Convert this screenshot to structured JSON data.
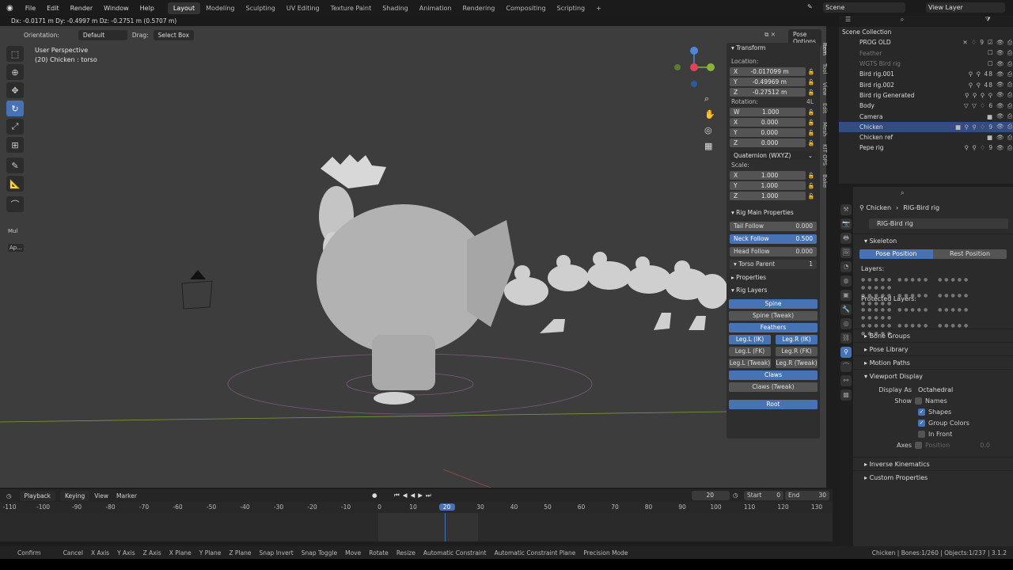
{
  "topbar": {
    "menus": [
      "File",
      "Edit",
      "Render",
      "Window",
      "Help"
    ],
    "workspaces": [
      "Layout",
      "Modeling",
      "Sculpting",
      "UV Editing",
      "Texture Paint",
      "Shading",
      "Animation",
      "Rendering",
      "Compositing",
      "Scripting"
    ],
    "active_workspace": "Layout",
    "scene": "Scene",
    "view_layer": "View Layer"
  },
  "viewport": {
    "header_text": "Dx: -0.0171 m   Dy: -0.4997 m   Dz: -0.2751 m (0.5707 m)",
    "orientation_label": "Orientation:",
    "orientation_value": "Default",
    "drag_label": "Drag:",
    "drag_value": "Select Box",
    "pose_options": "Pose Options",
    "perspective": "User Perspective",
    "object_info": "(20) Chicken : torso",
    "mul_label": "Mul",
    "ap_label": "Ap..."
  },
  "npanel": {
    "tabs": [
      "Item",
      "Tool",
      "View",
      "Edit",
      "Mesh",
      "KIT OPS",
      "Bake"
    ],
    "transform_title": "Transform",
    "location_label": "Location:",
    "location": [
      {
        "axis": "X",
        "value": "-0.017099 m"
      },
      {
        "axis": "Y",
        "value": "-0.49969 m"
      },
      {
        "axis": "Z",
        "value": "-0.27512 m"
      }
    ],
    "rotation_label": "Rotation:",
    "rotation_mode_tag": "4L",
    "rotation": [
      {
        "axis": "W",
        "value": "1.000"
      },
      {
        "axis": "X",
        "value": "0.000"
      },
      {
        "axis": "Y",
        "value": "0.000"
      },
      {
        "axis": "Z",
        "value": "0.000"
      }
    ],
    "rotation_mode": "Quaternion (WXYZ)",
    "scale_label": "Scale:",
    "scale": [
      {
        "axis": "X",
        "value": "1.000"
      },
      {
        "axis": "Y",
        "value": "1.000"
      },
      {
        "axis": "Z",
        "value": "1.000"
      }
    ],
    "rig_main_title": "Rig Main Properties",
    "tail_follow": {
      "label": "Tail Follow",
      "value": "0.000"
    },
    "neck_follow": {
      "label": "Neck Follow",
      "value": "0.500"
    },
    "head_follow": {
      "label": "Head Follow",
      "value": "0.000"
    },
    "torso_parent": {
      "label": "Torso Parent",
      "value": "1"
    },
    "properties_title": "Properties",
    "rig_layers_title": "Rig Layers",
    "layers": {
      "spine": "Spine",
      "spine_tweak": "Spine (Tweak)",
      "feathers": "Feathers",
      "leg_l_ik": "Leg.L (IK)",
      "leg_r_ik": "Leg.R (IK)",
      "leg_l_fk": "Leg.L (FK)",
      "leg_r_fk": "Leg.R (FK)",
      "leg_l_tweak": "Leg.L (Tweak)",
      "leg_r_tweak": "Leg.R (Tweak)",
      "claws": "Claws",
      "claws_tweak": "Claws (Tweak)",
      "root": "Root"
    }
  },
  "outliner": {
    "rows": [
      {
        "name": "Scene Collection",
        "icons": ""
      },
      {
        "name": "PROG OLD",
        "icons": "✕ ♢ 9"
      },
      {
        "name": "Feather",
        "icons": ""
      },
      {
        "name": "WGTS Bird rig",
        "icons": ""
      },
      {
        "name": "Bird rig.001",
        "icons": "⚲ ⚲ 48"
      },
      {
        "name": "Bird rig.002",
        "icons": "⚲ ⚲ 48"
      },
      {
        "name": "Bird rig Generated",
        "icons": "⚲ ⚲ ⚲ ⚲"
      },
      {
        "name": "Body",
        "icons": "▽ ▽ ♢ 6"
      },
      {
        "name": "Camera",
        "icons": "■"
      },
      {
        "name": "Chicken",
        "icons": "■ ⚲ ⚲ ♢ 9"
      },
      {
        "name": "Chicken ref",
        "icons": "■"
      },
      {
        "name": "Pepe rig",
        "icons": "⚲ ⚲ ♢ 9"
      }
    ]
  },
  "properties": {
    "breadcrumb_object": "Chicken",
    "breadcrumb_data": "RIG-Bird rig",
    "datablock": "RIG-Bird rig",
    "skeleton_title": "Skeleton",
    "pose_position": "Pose Position",
    "rest_position": "Rest Position",
    "layers_label": "Layers:",
    "protected_layers_label": "Protected Layers:",
    "bone_groups": "Bone Groups",
    "pose_library": "Pose Library",
    "motion_paths": "Motion Paths",
    "viewport_display": "Viewport Display",
    "display_as_label": "Display As",
    "display_as_value": "Octahedral",
    "show_label": "Show",
    "names": "Names",
    "shapes": "Shapes",
    "group_colors": "Group Colors",
    "in_front": "In Front",
    "axes_label": "Axes",
    "position_label": "Position",
    "position_value": "0.0",
    "inverse_kinematics": "Inverse Kinematics",
    "custom_properties": "Custom Properties"
  },
  "timeline": {
    "menus": [
      "Playback",
      "Keying",
      "View",
      "Marker"
    ],
    "current_frame": "20",
    "start_label": "Start",
    "start": "0",
    "end_label": "End",
    "end": "30",
    "ticks": [
      "-110",
      "-100",
      "-90",
      "-80",
      "-70",
      "-60",
      "-50",
      "-40",
      "-30",
      "-20",
      "-10",
      "0",
      "10",
      "20",
      "30",
      "40",
      "50",
      "60",
      "70",
      "80",
      "90",
      "100",
      "110",
      "120",
      "130"
    ]
  },
  "status": {
    "items": [
      "Confirm",
      "Cancel",
      "X Axis",
      "Y Axis",
      "Z Axis",
      "X Plane",
      "Y Plane",
      "Z Plane",
      "Snap Invert",
      "Snap Toggle",
      "Move",
      "Rotate",
      "Resize",
      "Automatic Constraint",
      "Automatic Constraint Plane",
      "Precision Mode"
    ],
    "stats": "Chicken | Bones:1/260 | Objects:1/237 | 3.1.2"
  },
  "colors": {
    "accent": "#4772b3",
    "viewport": "#3d3d3d",
    "panel": "#2e2e2e"
  }
}
